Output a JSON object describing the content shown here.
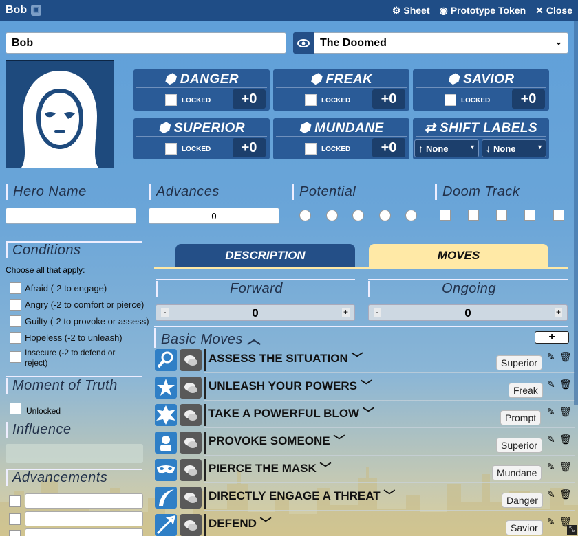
{
  "window": {
    "title": "Bob",
    "actions": [
      {
        "label": "Sheet",
        "icon": "gear-icon"
      },
      {
        "label": "Prototype Token",
        "icon": "user-circle-icon"
      },
      {
        "label": "Close",
        "icon": "close-icon"
      }
    ]
  },
  "character": {
    "name": "Bob",
    "playbook": "The Doomed"
  },
  "stats": [
    {
      "name": "DANGER",
      "locked_label": "LOCKED",
      "value": "+0"
    },
    {
      "name": "FREAK",
      "locked_label": "LOCKED",
      "value": "+0"
    },
    {
      "name": "SAVIOR",
      "locked_label": "LOCKED",
      "value": "+0"
    },
    {
      "name": "SUPERIOR",
      "locked_label": "LOCKED",
      "value": "+0"
    },
    {
      "name": "MUNDANE",
      "locked_label": "LOCKED",
      "value": "+0"
    }
  ],
  "shift": {
    "title": "SHIFT LABELS",
    "up": "None",
    "down": "None"
  },
  "fields": {
    "hero_name": "Hero Name",
    "hero_name_value": "",
    "advances": "Advances",
    "advances_value": "0",
    "potential": "Potential",
    "potential_filled": 0,
    "doom_track": "Doom Track",
    "doom_filled": 0
  },
  "conditions": {
    "title": "Conditions",
    "hint": "Choose all that apply:",
    "items": [
      "Afraid (-2 to engage)",
      "Angry (-2 to comfort or pierce)",
      "Guilty (-2 to provoke or assess)",
      "Hopeless (-2 to unleash)",
      "Insecure (-2 to defend or reject)"
    ]
  },
  "moment": {
    "title": "Moment of Truth",
    "label": "Unlocked"
  },
  "influence": {
    "title": "Influence",
    "value": ""
  },
  "advancements": {
    "title": "Advancements"
  },
  "tabs": [
    "DESCRIPTION",
    "MOVES"
  ],
  "forward": {
    "label": "Forward",
    "value": "0",
    "minus": "-",
    "plus": "+"
  },
  "ongoing": {
    "label": "Ongoing",
    "value": "0",
    "minus": "-",
    "plus": "+"
  },
  "moves_section": {
    "title": "Basic Moves",
    "add": "+"
  },
  "moves": [
    {
      "name": "ASSESS THE SITUATION",
      "tag": "Superior",
      "icon": "magnifier-icon"
    },
    {
      "name": "UNLEASH YOUR POWERS",
      "tag": "Freak",
      "icon": "power-burst-icon"
    },
    {
      "name": "TAKE A POWERFUL BLOW",
      "tag": "Prompt",
      "icon": "impact-icon"
    },
    {
      "name": "PROVOKE SOMEONE",
      "tag": "Superior",
      "icon": "provoke-icon"
    },
    {
      "name": "PIERCE THE MASK",
      "tag": "Mundane",
      "icon": "mask-icon"
    },
    {
      "name": "DIRECTLY ENGAGE A THREAT",
      "tag": "Danger",
      "icon": "slash-icon"
    },
    {
      "name": "DEFEND",
      "tag": "Savior",
      "icon": "shield-arrow-icon"
    }
  ],
  "colors": {
    "titlebar": "#1f4d86",
    "stat_bg": "#2a5b97",
    "active_tab": "#ffe9a6",
    "inactive_tab": "#244f87"
  }
}
